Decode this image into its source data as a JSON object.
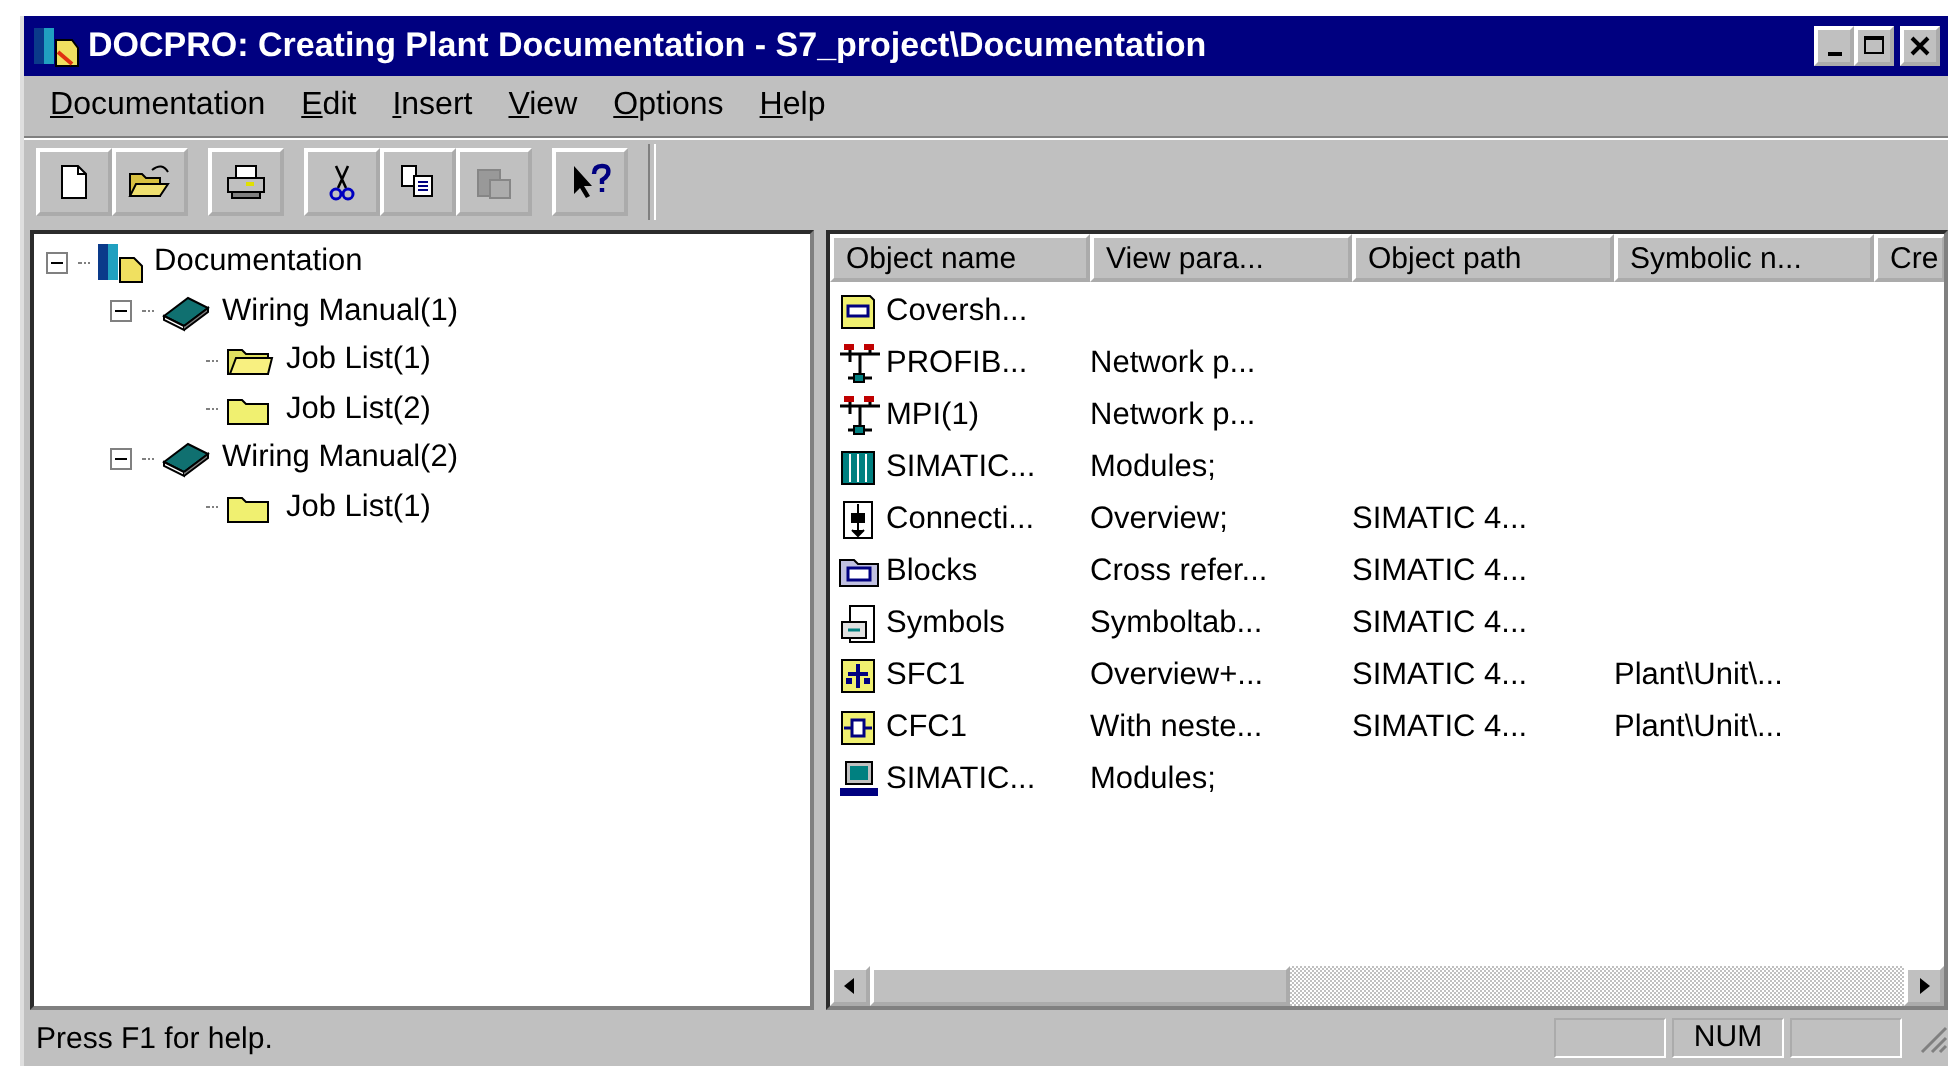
{
  "window": {
    "title": "DOCPRO: Creating Plant Documentation - S7_project\\Documentation"
  },
  "menu": [
    "Documentation",
    "Edit",
    "Insert",
    "View",
    "Options",
    "Help"
  ],
  "toolbar": [
    {
      "kind": "new",
      "disabled": false
    },
    {
      "kind": "open",
      "disabled": false
    },
    {
      "kind": "print",
      "disabled": false
    },
    {
      "kind": "cut",
      "disabled": false
    },
    {
      "kind": "copy",
      "disabled": false
    },
    {
      "kind": "paste",
      "disabled": true
    },
    {
      "kind": "help",
      "disabled": false
    }
  ],
  "tree": [
    {
      "label": "Documentation",
      "kind": "docs",
      "expanded": true,
      "children": [
        {
          "label": "Wiring Manual(1)",
          "kind": "book",
          "expanded": true,
          "children": [
            {
              "label": "Job List(1)",
              "kind": "open-folder"
            },
            {
              "label": "Job List(2)",
              "kind": "folder"
            }
          ]
        },
        {
          "label": "Wiring Manual(2)",
          "kind": "book",
          "expanded": true,
          "children": [
            {
              "label": "Job List(1)",
              "kind": "folder"
            }
          ]
        }
      ]
    }
  ],
  "table": {
    "columns": [
      "Object name",
      "View para...",
      "Object path",
      "Symbolic n...",
      "Cre"
    ],
    "rows": [
      {
        "kind": "cover",
        "object_name": "Coversh..."
      },
      {
        "kind": "network",
        "object_name": "PROFIB...",
        "view_parameters": "Network p..."
      },
      {
        "kind": "network",
        "object_name": "MPI(1)",
        "view_parameters": "Network p..."
      },
      {
        "kind": "rack",
        "object_name": "SIMATIC...",
        "view_parameters": "Modules;"
      },
      {
        "kind": "connection",
        "object_name": "Connecti...",
        "view_parameters": "Overview;",
        "object_path": "SIMATIC 4..."
      },
      {
        "kind": "blocks",
        "object_name": "Blocks",
        "view_parameters": "Cross refer...",
        "object_path": "SIMATIC 4..."
      },
      {
        "kind": "symbols",
        "object_name": "Symbols",
        "view_parameters": "Symboltab...",
        "object_path": "SIMATIC 4..."
      },
      {
        "kind": "sfc",
        "object_name": "SFC1",
        "view_parameters": "Overview+...",
        "object_path": "SIMATIC 4...",
        "symbolic_name": "Plant\\Unit\\..."
      },
      {
        "kind": "cfc",
        "object_name": "CFC1",
        "view_parameters": "With neste...",
        "object_path": "SIMATIC 4...",
        "symbolic_name": "Plant\\Unit\\..."
      },
      {
        "kind": "station",
        "object_name": "SIMATIC...",
        "view_parameters": "Modules;"
      }
    ]
  },
  "status_bar": {
    "message": "Press F1 for help.",
    "num_indicator": "NUM"
  }
}
